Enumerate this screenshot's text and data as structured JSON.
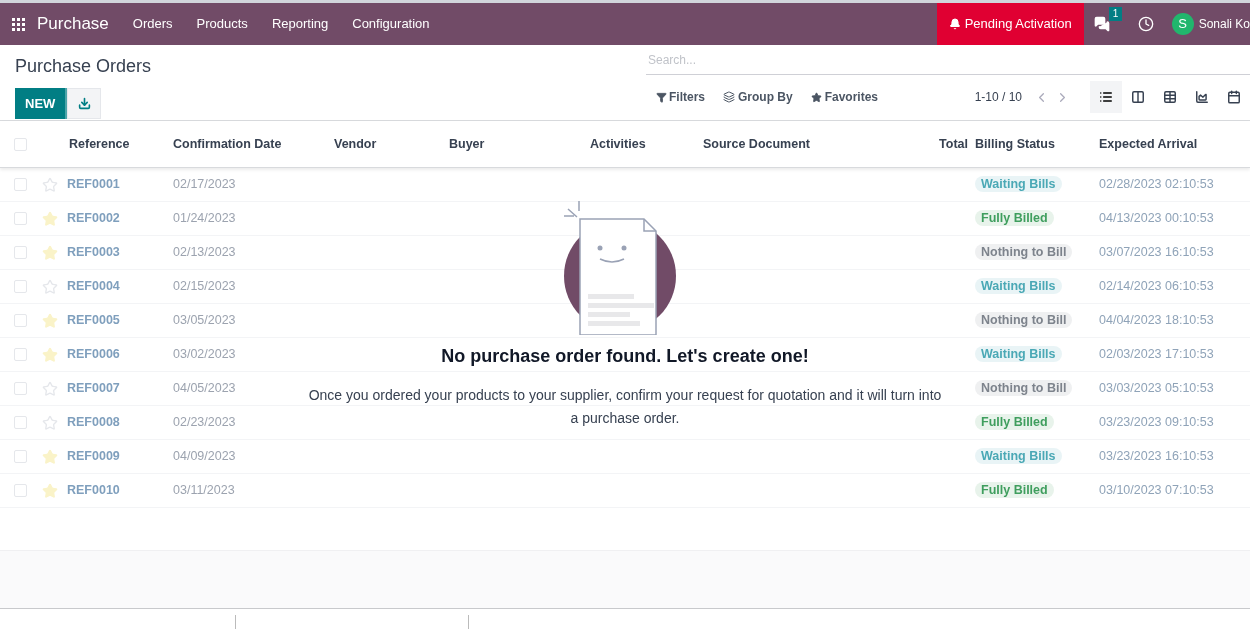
{
  "navbar": {
    "app": "Purchase",
    "menu": [
      "Orders",
      "Products",
      "Reporting",
      "Configuration"
    ],
    "alert": "Pending Activation",
    "messages_count": "1",
    "user_initial": "S",
    "user_name": "Sonali Ko"
  },
  "control_panel": {
    "title": "Purchase Orders",
    "new_button": "NEW",
    "search": {
      "placeholder": "Search..."
    },
    "filters": "Filters",
    "group_by": "Group By",
    "favorites": "Favorites",
    "pager": "1-10 / 10",
    "views": [
      {
        "kind": "list",
        "selected": true
      },
      {
        "kind": "kanban",
        "selected": false
      },
      {
        "kind": "pivot",
        "selected": false
      },
      {
        "kind": "graph",
        "selected": false
      },
      {
        "kind": "calendar",
        "selected": false
      }
    ]
  },
  "table": {
    "select_all_checked": false,
    "columns": [
      "Reference",
      "Confirmation Date",
      "Vendor",
      "Buyer",
      "Activities",
      "Source Document",
      "Total",
      "Billing Status",
      "Expected Arrival"
    ],
    "rows": [
      {
        "checked": false,
        "starred": false,
        "reference": "REF0001",
        "date": "02/17/2023",
        "billing": "Waiting Bills",
        "color": "#4aa8b5",
        "arrival": "02/28/2023 02:10:53"
      },
      {
        "checked": false,
        "starred": true,
        "reference": "REF0002",
        "date": "01/24/2023",
        "billing": "Fully Billed",
        "color": "#3f9e5e",
        "arrival": "04/13/2023 00:10:53"
      },
      {
        "checked": false,
        "starred": true,
        "reference": "REF0003",
        "date": "02/13/2023",
        "billing": "Nothing to Bill",
        "color": "#7d838c",
        "arrival": "03/07/2023 16:10:53"
      },
      {
        "checked": false,
        "starred": false,
        "reference": "REF0004",
        "date": "02/15/2023",
        "billing": "Waiting Bills",
        "color": "#4aa8b5",
        "arrival": "02/14/2023 06:10:53"
      },
      {
        "checked": false,
        "starred": true,
        "reference": "REF0005",
        "date": "03/05/2023",
        "billing": "Nothing to Bill",
        "color": "#7d838c",
        "arrival": "04/04/2023 18:10:53"
      },
      {
        "checked": false,
        "starred": true,
        "reference": "REF0006",
        "date": "03/02/2023",
        "billing": "Waiting Bills",
        "color": "#4aa8b5",
        "arrival": "02/03/2023 17:10:53"
      },
      {
        "checked": false,
        "starred": false,
        "reference": "REF0007",
        "date": "04/05/2023",
        "billing": "Nothing to Bill",
        "color": "#7d838c",
        "arrival": "03/03/2023 05:10:53"
      },
      {
        "checked": false,
        "starred": false,
        "reference": "REF0008",
        "date": "02/23/2023",
        "billing": "Fully Billed",
        "color": "#3f9e5e",
        "arrival": "03/23/2023 09:10:53"
      },
      {
        "checked": false,
        "starred": true,
        "reference": "REF0009",
        "date": "04/09/2023",
        "billing": "Waiting Bills",
        "color": "#4aa8b5",
        "arrival": "03/23/2023 16:10:53"
      },
      {
        "checked": false,
        "starred": true,
        "reference": "REF0010",
        "date": "03/11/2023",
        "billing": "Fully Billed",
        "color": "#3f9e5e",
        "arrival": "03/10/2023 07:10:53"
      }
    ]
  },
  "empty_state": {
    "title": "No purchase order found. Let's create one!",
    "text": "Once you ordered your products to your supplier, confirm your request for quotation and it will turn into a purchase order."
  }
}
